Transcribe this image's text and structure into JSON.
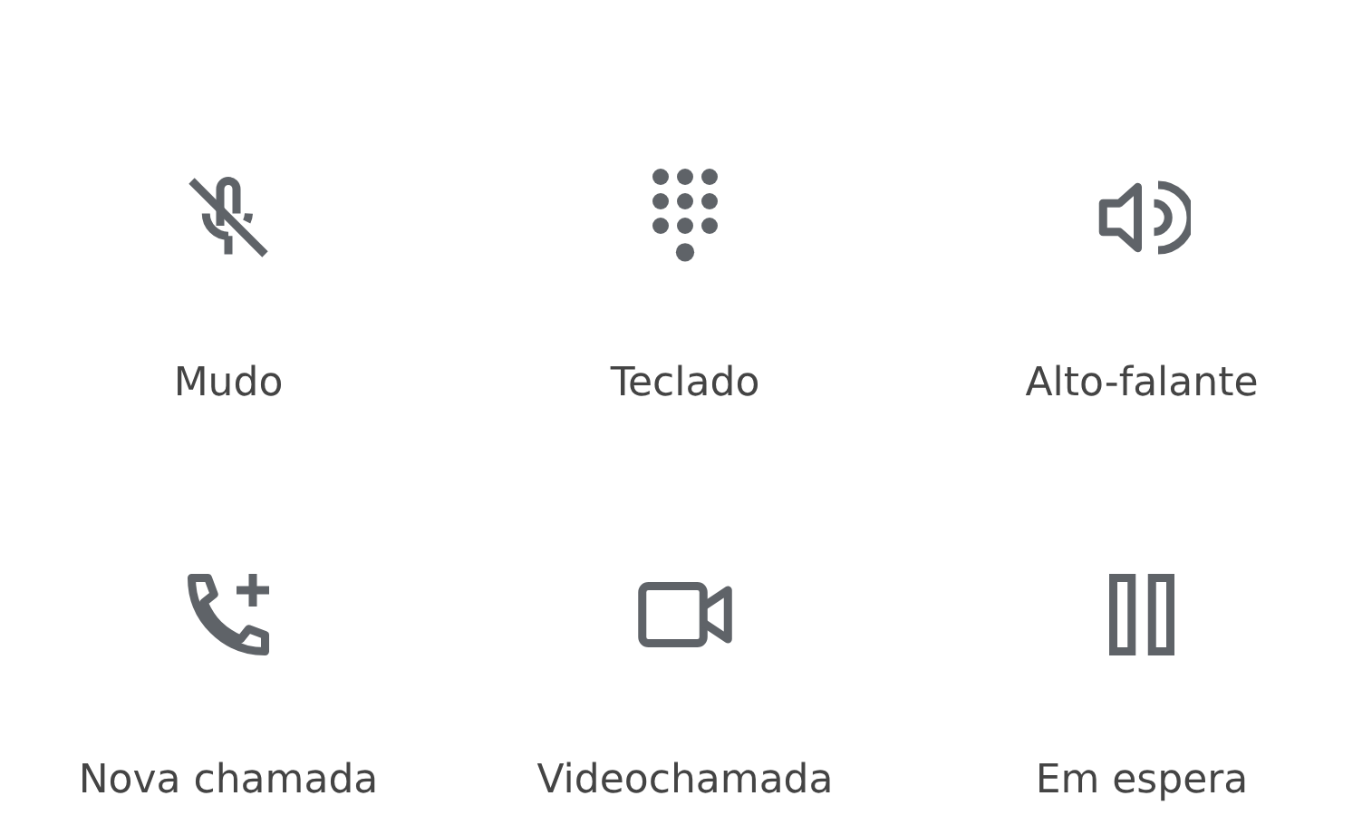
{
  "buttons": [
    {
      "kind": "mute",
      "label": "Mudo"
    },
    {
      "kind": "keypad",
      "label": "Teclado"
    },
    {
      "kind": "speaker",
      "label": "Alto-falante"
    },
    {
      "kind": "add-call",
      "label": "Nova chamada"
    },
    {
      "kind": "video",
      "label": "Videochamada"
    },
    {
      "kind": "hold",
      "label": "Em espera"
    }
  ]
}
